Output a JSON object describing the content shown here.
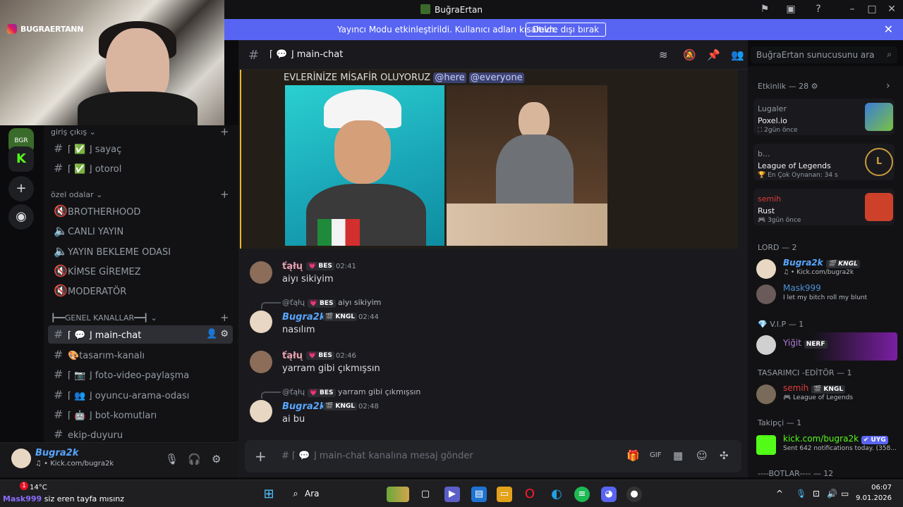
{
  "window": {
    "title": "BuğraErtan"
  },
  "banner": {
    "text": "Yayıncı Modu etkinleştirildi. Kullanıcı adları kısaltıldı.",
    "button": "Devre dışı bırak"
  },
  "webcam": {
    "tag": "BUGRAERTANN"
  },
  "channels": {
    "categories": [
      {
        "label": "giriş çıkış ⌄"
      },
      {
        "label": "özel odalar ⌄"
      },
      {
        "label": "┣━━GENEL KANALLAR━━┫ ⌄"
      }
    ],
    "items": [
      {
        "label": "⌈ ✅ ⌋ sayaç"
      },
      {
        "label": "⌈ ✅ ⌋ otorol"
      },
      {
        "label": "BROTHERHOOD"
      },
      {
        "label": "CANLI YAYIN"
      },
      {
        "label": "YAYIN BEKLEME ODASI"
      },
      {
        "label": "KİMSE GİREMEZ"
      },
      {
        "label": "MODERATÖR"
      },
      {
        "label": "⌈ 💬 ⌋ main-chat"
      },
      {
        "label": "🎨tasarım-kanalı"
      },
      {
        "label": "⌈ 📷 ⌋ foto-video-paylaşma"
      },
      {
        "label": "⌈ 👥 ⌋ oyuncu-arama-odası"
      },
      {
        "label": "⌈ 🤖 ⌋ bot-komutları"
      },
      {
        "label": "ekip-duyuru"
      }
    ]
  },
  "user": {
    "name": "Bugra2k",
    "status": "♫ • Kick.com/bugra2k"
  },
  "header": {
    "channel": "⌈ 💬 ⌋ main-chat",
    "search_placeholder": "BuğraErtan sunucusunu ara"
  },
  "highlight": {
    "text": "EVLERİNİZE MİSAFİR OLUYORUZ",
    "m1": "@here",
    "m2": "@everyone"
  },
  "messages": [
    {
      "name": "ťąłų",
      "badge": "💗 BES",
      "time": "02:41",
      "body": "aiyı sikiyim"
    },
    {
      "reply_name": "@ťąłų",
      "reply_badge": "💗 BES",
      "reply_text": "aiyı sikiyim",
      "name": "Bugra2k",
      "badge": "🎬 KNGL",
      "time": "02:44",
      "body": "nasılım"
    },
    {
      "name": "ťąłų",
      "badge": "💗 BES",
      "time": "02:46",
      "body": "yarram gibi çıkmışsın"
    },
    {
      "reply_name": "@ťąłų",
      "reply_badge": "💗 BES",
      "reply_text": "yarram gibi çıkmışsın",
      "name": "Bugra2k",
      "badge": "🎬 KNGL",
      "time": "02:48",
      "body": "ai bu"
    }
  ],
  "composer": {
    "placeholder": "# ⌈ 💬 ⌋ main-chat kanalına mesaj gönder"
  },
  "members": {
    "activity_header": "Etkinlik — 28 ⚙",
    "activities": [
      {
        "user": "Lugaler",
        "game": "Poxel.io",
        "time": "⛶ 2gün önce"
      },
      {
        "user": "b...",
        "game": "League of Legends",
        "time": "🏆 En Çok Oynanan: 34 s"
      },
      {
        "user": "semih",
        "game": "Rust",
        "time": "🎮 3gün önce"
      }
    ],
    "sections": [
      {
        "label": "LORD — 2"
      },
      {
        "label": "💎 V.I.P — 1"
      },
      {
        "label": "TASARIMCI -EDİTÖR — 1"
      },
      {
        "label": "Takipçi — 1"
      },
      {
        "label": "----BOTLAR---- — 12"
      }
    ],
    "list": [
      {
        "name": "Bugra2k",
        "badge": "🎬 KNGL",
        "status": "♫ • Kick.com/bugra2k"
      },
      {
        "name": "Mask999",
        "status": "I let my bitch roll my blunt"
      },
      {
        "name": "Yiğit",
        "badge": "NERF"
      },
      {
        "name": "semih",
        "badge": "🎬 KNGL",
        "status": "🎮 League of Legends"
      },
      {
        "name": "kick.com/bugra2k",
        "badge": "✔ UYG",
        "status": "Sent 642 notifications today. (358..."
      }
    ]
  },
  "taskbar": {
    "weather": "14°C",
    "ticker": "siz eren tayfa mısınz",
    "ticker_user": "Mask999",
    "search": "Ara",
    "time": "06:07",
    "date": "9.01.2026",
    "badge_count": "1"
  }
}
